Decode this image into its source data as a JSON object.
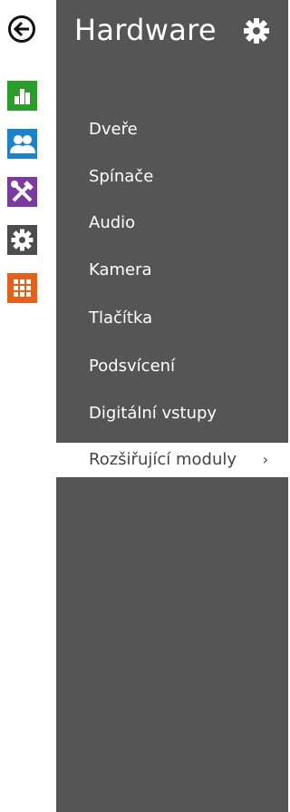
{
  "header": {
    "title": "Hardware"
  },
  "menu": {
    "items": [
      {
        "label": "Dveře"
      },
      {
        "label": "Spínače"
      },
      {
        "label": "Audio"
      },
      {
        "label": "Kamera"
      },
      {
        "label": "Tlačítka"
      },
      {
        "label": "Podsvícení"
      },
      {
        "label": "Digitální vstupy"
      },
      {
        "label": "Rozšiřující moduly",
        "active": true,
        "chevron": "chevron-right-icon"
      }
    ]
  },
  "rail": {
    "icons": [
      {
        "name": "chart-icon",
        "color": "#2a9d2a"
      },
      {
        "name": "users-icon",
        "color": "#1e82c8"
      },
      {
        "name": "tools-icon",
        "color": "#7b3aa0"
      },
      {
        "name": "gear-icon",
        "color": "#4d4d4d"
      },
      {
        "name": "grid-icon",
        "color": "#e0621e"
      }
    ]
  },
  "colors": {
    "panel": "#555555",
    "accent_active": "#ffffff"
  }
}
